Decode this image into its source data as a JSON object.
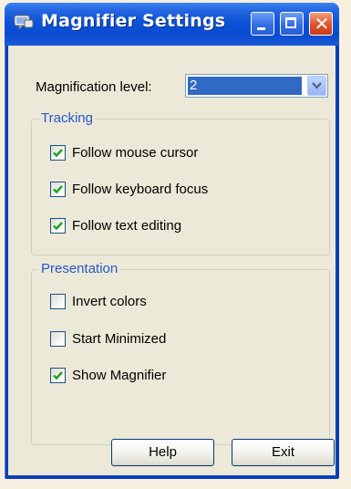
{
  "window": {
    "title": "Magnifier Settings",
    "colors": {
      "titlebar": "#0a4bd0",
      "client": "#ece9d8",
      "group_legend": "#2458c8",
      "selection": "#316ac5",
      "close_button": "#e0522a"
    }
  },
  "titlebar_buttons": {
    "minimize_icon": "minimize-icon",
    "maximize_icon": "maximize-icon",
    "close_icon": "close-icon",
    "close_glyph": "✕"
  },
  "magnification": {
    "label": "Magnification level:",
    "value": "2"
  },
  "tracking": {
    "legend": "Tracking",
    "options": [
      {
        "label": "Follow mouse cursor",
        "checked": true
      },
      {
        "label": "Follow keyboard focus",
        "checked": true
      },
      {
        "label": "Follow text editing",
        "checked": true
      }
    ]
  },
  "presentation": {
    "legend": "Presentation",
    "options": [
      {
        "label": "Invert colors",
        "checked": false
      },
      {
        "label": "Start Minimized",
        "checked": false
      },
      {
        "label": "Show Magnifier",
        "checked": true
      }
    ]
  },
  "buttons": {
    "help": "Help",
    "exit": "Exit"
  }
}
